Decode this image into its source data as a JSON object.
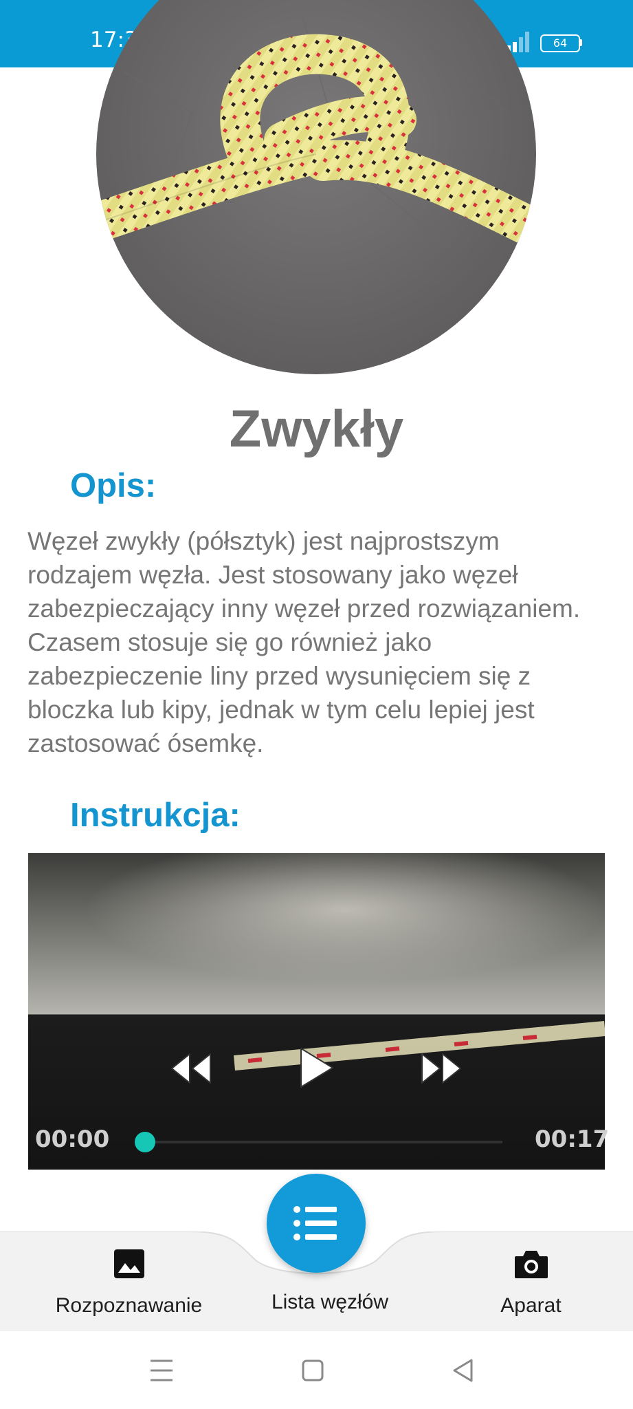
{
  "status_bar": {
    "time": "17:33",
    "battery": "64",
    "color": "#0a9bd5"
  },
  "knot": {
    "name": "Zwykły",
    "description_heading": "Opis:",
    "description": "Węzeł zwykły (półsztyk) jest najprostszym rodzajem węzła. Jest stosowany jako węzeł zabezpieczający inny węzeł przed rozwiązaniem. Czasem stosuje się go również jako zabezpieczenie liny przed wysunięciem się z bloczka lub kipy, jednak w tym celu lepiej jest zastosować ósemkę.",
    "instruction_heading": "Instrukcja:"
  },
  "video": {
    "current_time": "00:00",
    "duration": "00:17",
    "progress": 0,
    "accent": "#16c7b6"
  },
  "bottom_nav": {
    "items": [
      {
        "label": "Rozpoznawanie",
        "icon": "image-icon"
      },
      {
        "label": "Lista węzłów",
        "icon": "list-icon",
        "active": true
      },
      {
        "label": "Aparat",
        "icon": "camera-icon"
      }
    ],
    "accent": "#129bd8"
  },
  "system_nav": {
    "icons": [
      "menu-icon",
      "home-icon",
      "back-icon"
    ]
  }
}
